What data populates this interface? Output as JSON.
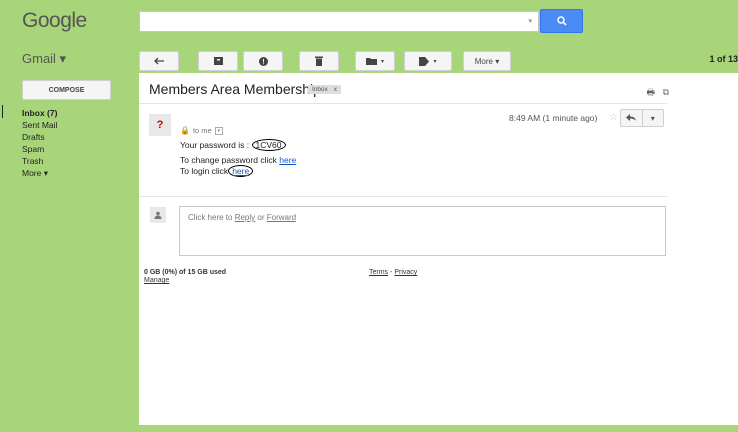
{
  "header": {
    "logo": "Google",
    "search_placeholder": ""
  },
  "gmail": {
    "label": "Gmail ▾"
  },
  "toolbar": {
    "more_label": "More ▾",
    "page_count": "1 of 13"
  },
  "sidebar": {
    "compose_label": "COMPOSE",
    "items": [
      {
        "label": "Inbox (7)",
        "bold": true
      },
      {
        "label": "Sent Mail"
      },
      {
        "label": "Drafts"
      },
      {
        "label": "Spam"
      },
      {
        "label": "Trash"
      },
      {
        "label": "More ▾"
      }
    ]
  },
  "message": {
    "subject": "Members Area Membership",
    "label": "Inbox",
    "label_close": "x",
    "sender_avatar": "?",
    "to": "to me",
    "time": "8:49 AM (1 minute ago)",
    "password_prefix": "Your password is :",
    "password_value": "1CV60",
    "change_text": "To change password click",
    "change_link": "here",
    "login_text": "To login click",
    "login_link": "here"
  },
  "reply": {
    "prefix": "Click here to",
    "reply_link": "Reply",
    "or": "or",
    "forward_link": "Forward"
  },
  "footer": {
    "quota": "0 GB (0%) of 15 GB used",
    "manage": "Manage",
    "terms": "Terms",
    "dash": "-",
    "privacy": "Privacy"
  },
  "colors": {
    "background": "#a8d57a",
    "search_button": "#4a8af4",
    "link": "#15c",
    "lock": "#d00"
  }
}
